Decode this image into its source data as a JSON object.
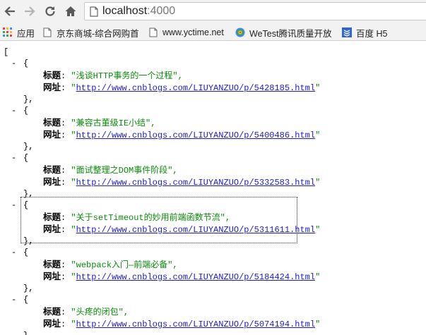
{
  "browser": {
    "url_host": "localhost",
    "url_port": ":4000"
  },
  "bookmarks": [
    {
      "label": "应用",
      "icon": "apps-grid-icon"
    },
    {
      "label": "京东商城-综合网购首",
      "icon": "page-icon"
    },
    {
      "label": "www.yctime.net",
      "icon": "page-icon"
    },
    {
      "label": "WeTest腾讯质量开放",
      "icon": "wetest-icon"
    },
    {
      "label": "百度 H5",
      "icon": "baidu-h5-icon"
    }
  ],
  "json_view": {
    "open_bracket": "[",
    "toggle_glyph": "-",
    "open_brace": "{",
    "close_brace": "},",
    "items": [
      {
        "title_key": "标题",
        "title": "\"浅谈HTTP事务的一个过程\",",
        "url_key": "网址",
        "url": "http://www.cnblogs.com/LIUYANZUO/p/5428185.html"
      },
      {
        "title_key": "标题",
        "title": "\"兼容古董级IE小结\",",
        "url_key": "网址",
        "url": "http://www.cnblogs.com/LIUYANZUO/p/5400486.html"
      },
      {
        "title_key": "标题",
        "title": "\"面试整理之DOM事件阶段\",",
        "url_key": "网址",
        "url": "http://www.cnblogs.com/LIUYANZUO/p/5332583.html"
      },
      {
        "title_key": "标题",
        "title": "\"关于setTimeout的妙用前端函数节流\",",
        "url_key": "网址",
        "url": "http://www.cnblogs.com/LIUYANZUO/p/5311611.html"
      },
      {
        "title_key": "标题",
        "title": "\"webpack入门—前端必备\",",
        "url_key": "网址",
        "url": "http://www.cnblogs.com/LIUYANZUO/p/5184424.html"
      },
      {
        "title_key": "标题",
        "title": "\"头疼的闭包\",",
        "url_key": "网址",
        "url": "http://www.cnblogs.com/LIUYANZUO/p/5074194.html"
      }
    ]
  }
}
